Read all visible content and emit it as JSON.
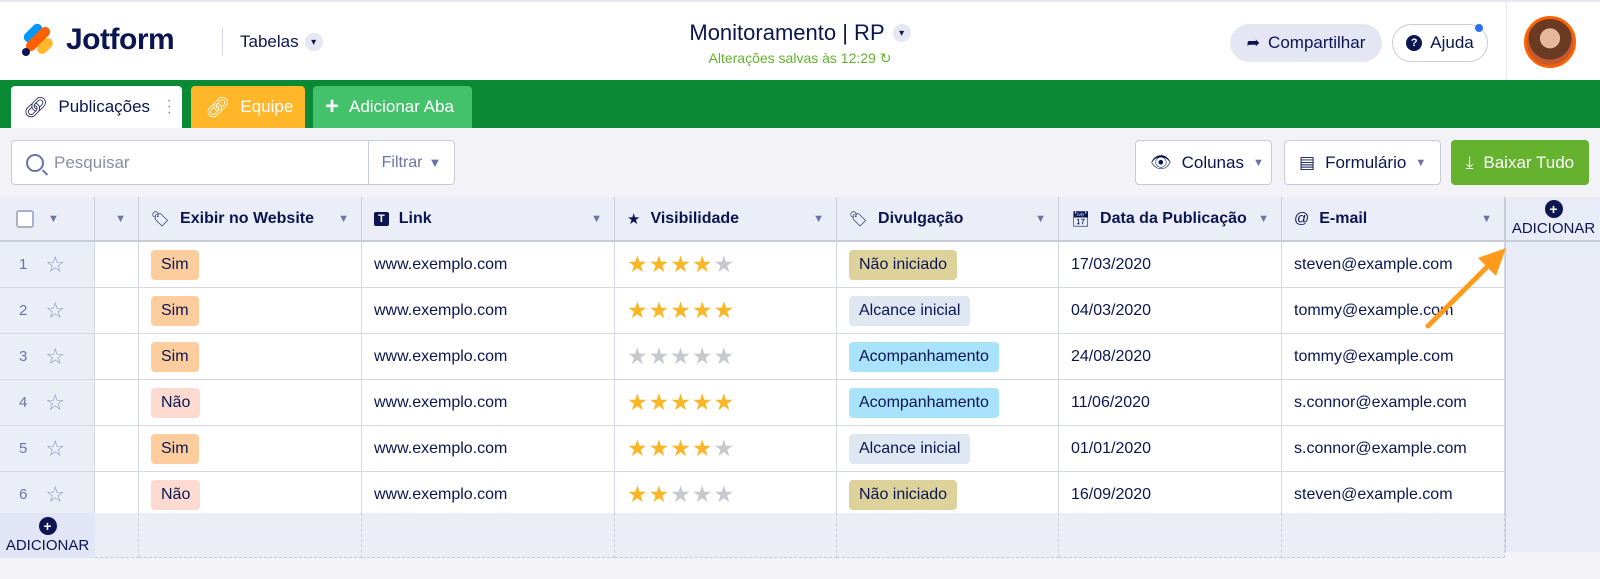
{
  "app": {
    "brand": "Jotform",
    "tables_menu": "Tabelas",
    "title": "Monitoramento | RP",
    "saved_status": "Alterações salvas às 12:29",
    "share_label": "Compartilhar",
    "help_label": "Ajuda"
  },
  "tabs": [
    {
      "label": "Publicações",
      "color": "#ffffff",
      "icon": "link-icon"
    },
    {
      "label": "Equipe",
      "color": "#ffb629",
      "icon": "link-icon"
    },
    {
      "label": "Adicionar Aba",
      "color": "#43c26b",
      "icon": "plus-icon"
    }
  ],
  "tab_bar_color": "#0b8a35",
  "toolbar": {
    "search_placeholder": "Pesquisar",
    "filter_label": "Filtrar",
    "columns_label": "Colunas",
    "form_label": "Formulário",
    "download_label": "Baixar Tudo",
    "download_color": "#64b22e"
  },
  "columns": [
    {
      "label": "Exibir no Website",
      "icon": "tag-icon"
    },
    {
      "label": "Link",
      "icon": "text-icon"
    },
    {
      "label": "Visibilidade",
      "icon": "star-icon"
    },
    {
      "label": "Divulgação",
      "icon": "tag-icon"
    },
    {
      "label": "Data da Publicação",
      "icon": "calendar-icon"
    },
    {
      "label": "E-mail",
      "icon": "at-icon"
    }
  ],
  "add_label": "ADICIONAR",
  "rows": [
    {
      "num": "1",
      "website": "Sim",
      "link": "www.exemplo.com",
      "rating": 4,
      "status": "Não iniciado",
      "date": "17/03/2020",
      "email": "steven@example.com"
    },
    {
      "num": "2",
      "website": "Sim",
      "link": "www.exemplo.com",
      "rating": 5,
      "status": "Alcance inicial",
      "date": "04/03/2020",
      "email": "tommy@example.com"
    },
    {
      "num": "3",
      "website": "Sim",
      "link": "www.exemplo.com",
      "rating": 0,
      "status": "Acompanhamento",
      "date": "24/08/2020",
      "email": "tommy@example.com"
    },
    {
      "num": "4",
      "website": "Não",
      "link": "www.exemplo.com",
      "rating": 5,
      "status": "Acompanhamento",
      "date": "11/06/2020",
      "email": "s.connor@example.com"
    },
    {
      "num": "5",
      "website": "Sim",
      "link": "www.exemplo.com",
      "rating": 4,
      "status": "Alcance inicial",
      "date": "01/01/2020",
      "email": "s.connor@example.com"
    },
    {
      "num": "6",
      "website": "Não",
      "link": "www.exemplo.com",
      "rating": 2,
      "status": "Não iniciado",
      "date": "16/09/2020",
      "email": "steven@example.com"
    }
  ],
  "status_colors": {
    "Não iniciado": "#ddd39a",
    "Alcance inicial": "#dfe7f3",
    "Acompanhamento": "#a8e2fb"
  },
  "website_colors": {
    "Sim": "#fdcd9e",
    "Não": "#fddad0"
  },
  "arrow_color": "#ff9b1c"
}
